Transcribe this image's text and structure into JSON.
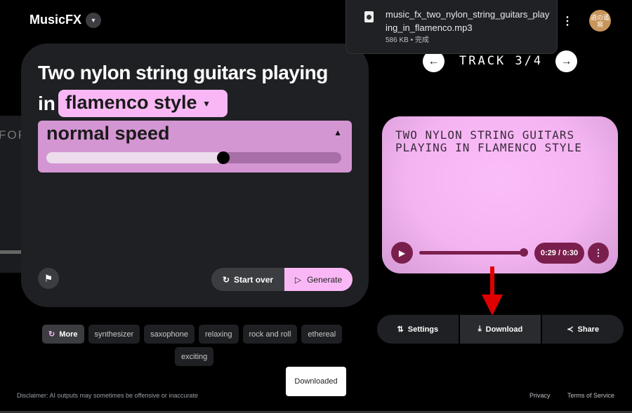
{
  "header": {
    "app_name": "MusicFX",
    "app_menu_icon": "chevron-down-icon",
    "more_icon": "more-vert-icon",
    "avatar_text": "逍の遙窩"
  },
  "download_popup": {
    "file_name": "music_fx_two_nylon_string_guitars_playing_in_flamenco.mp3",
    "meta": "586 KB • 完成"
  },
  "track_nav": {
    "label": "TRACK 3/4",
    "current": 3,
    "total": 4
  },
  "side_card": {
    "text": "FOR"
  },
  "prompt": {
    "line1": "Two nylon string guitars playing",
    "line2_prefix": "in",
    "style_chip": "flamenco style",
    "speed_chip": "normal speed",
    "speed_slider_value": 0.6,
    "start_over": "Start over",
    "generate": "Generate"
  },
  "suggestions": {
    "more": "More",
    "chips": [
      "synthesizer",
      "saxophone",
      "relaxing",
      "rock and roll",
      "ethereal",
      "exciting"
    ]
  },
  "result": {
    "title": "TWO NYLON STRING GUITARS PLAYING IN FLAMENCO STYLE",
    "time": "0:29 / 0:30",
    "progress": 0.97,
    "card_color": "#f9b8f5",
    "player_color": "#7a1f4d"
  },
  "actions": {
    "settings": "Settings",
    "download": "Download",
    "share": "Share"
  },
  "annotation_color": "#e00000",
  "toast": "Downloaded",
  "footer": {
    "disclaimer": "Disclaimer: AI outputs may sometimes be offensive or inaccurate",
    "privacy": "Privacy",
    "terms": "Terms of Service"
  }
}
